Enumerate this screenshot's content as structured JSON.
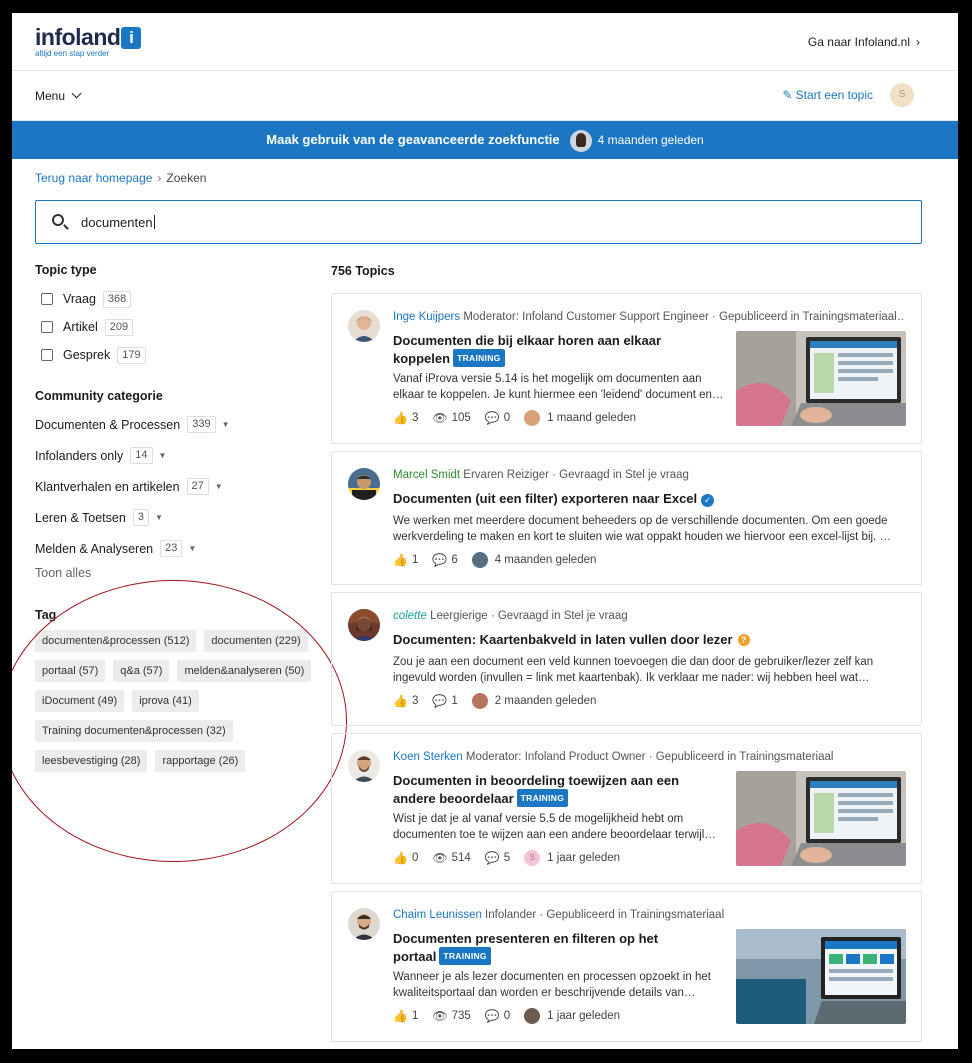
{
  "header": {
    "logo_word": "infoland",
    "logo_badge": "i",
    "logo_tagline": "altijd een stap verder",
    "goto_link": "Ga naar Infoland.nl",
    "menu_label": "Menu",
    "start_topic": "Start een topic",
    "user_initial": "S"
  },
  "banner": {
    "text": "Maak gebruik van de geavanceerde zoekfunctie",
    "when": "4 maanden geleden"
  },
  "breadcrumb": {
    "home": "Terug naar homepage",
    "current": "Zoeken"
  },
  "search": {
    "value": "documenten"
  },
  "sidebar": {
    "topic_type_heading": "Topic type",
    "topic_types": [
      {
        "label": "Vraag",
        "count": "368"
      },
      {
        "label": "Artikel",
        "count": "209"
      },
      {
        "label": "Gesprek",
        "count": "179"
      }
    ],
    "category_heading": "Community categorie",
    "categories": [
      {
        "label": "Documenten & Processen",
        "count": "339"
      },
      {
        "label": "Infolanders only",
        "count": "14"
      },
      {
        "label": "Klantverhalen en artikelen",
        "count": "27"
      },
      {
        "label": "Leren & Toetsen",
        "count": "3"
      },
      {
        "label": "Melden & Analyseren",
        "count": "23"
      }
    ],
    "show_all": "Toon alles",
    "tag_heading": "Tag",
    "tags": [
      "documenten&processen (512)",
      "documenten (229)",
      "portaal (57)",
      "q&a (57)",
      "melden&analyseren (50)",
      "iDocument (49)",
      "iprova (41)",
      "Training documenten&processen (32)",
      "leesbevestiging (28)",
      "rapportage (26)"
    ]
  },
  "results": {
    "heading": "756 Topics",
    "items": [
      {
        "author": "Inge Kuijpers",
        "meta": " Moderator: Infoland Customer Support Engineer · Gepubliceerd in Trainingsmateriaal…",
        "title_line1": "Documenten die bij elkaar horen aan elkaar",
        "title_line2": "koppelen",
        "badge": "TRAINING",
        "excerpt1": "Vanaf iProva versie 5.14 is het mogelijk om documenten aan",
        "excerpt2": "elkaar te koppelen. Je kunt hiermee een 'leidend' document en…",
        "likes": "3",
        "views": "105",
        "comments": "0",
        "when": "1 maand geleden"
      },
      {
        "author": "Marcel Smidt",
        "meta": " Ervaren Reiziger · Gevraagd in Stel je vraag",
        "title_line1": "Documenten (uit een filter) exporteren naar Excel",
        "excerpt1": "We werken met meerdere document beheeders op de verschillende documenten. Om een goede",
        "excerpt2": "werkverdeling te maken en kort te sluiten wie wat oppakt houden we hiervoor een excel-lijst bij. …",
        "likes": "1",
        "comments": "6",
        "when": "4 maanden geleden",
        "verified_icon": "✓"
      },
      {
        "author": "colette",
        "meta": " Leergierige · Gevraagd in Stel je vraag",
        "title_line1": "Documenten: Kaartenbakveld in laten vullen door lezer",
        "excerpt1": "Zou je aan een document een veld kunnen toevoegen die dan door de gebruiker/lezer zelf kan",
        "excerpt2": "ingevuld worden (invullen = link met kaartenbak). Ik verklaar me nader: wij hebben heel wat…",
        "likes": "3",
        "comments": "1",
        "when": "2 maanden geleden",
        "question_icon": "?"
      },
      {
        "author": "Koen Sterken",
        "meta": " Moderator: Infoland Product Owner · Gepubliceerd in Trainingsmateriaal",
        "title_line1": "Documenten in beoordeling toewijzen aan een",
        "title_line2": "andere beoordelaar",
        "badge": "TRAINING",
        "excerpt1": "Wist je dat je al vanaf versie 5.5 de mogelijkheid hebt om",
        "excerpt2": "documenten toe te wijzen aan een andere beoordelaar terwijl…",
        "likes": "0",
        "views": "514",
        "comments": "5",
        "when": "1 jaar geleden",
        "mini_initial": "S"
      },
      {
        "author": "Chaim Leunissen",
        "meta": " Infolander · Gepubliceerd in Trainingsmateriaal",
        "title_line1": "Documenten presenteren en filteren op het",
        "title_line2": "portaal",
        "badge": "TRAINING",
        "excerpt1": "Wanneer je als lezer documenten en processen opzoekt in het",
        "excerpt2": "kwaliteitsportaal dan worden er beschrijvende details van…",
        "likes": "1",
        "views": "735",
        "comments": "0",
        "when": "1 jaar geleden"
      }
    ]
  },
  "icons": {
    "like": "👍",
    "view": "👁",
    "comment": "💬",
    "chevron_right": "›",
    "chevron_down": "⌄",
    "dropdown": "▼",
    "pencil": "✎"
  },
  "colors": {
    "brand_blue": "#1b76c4",
    "annotation_red": "#a0141a"
  }
}
